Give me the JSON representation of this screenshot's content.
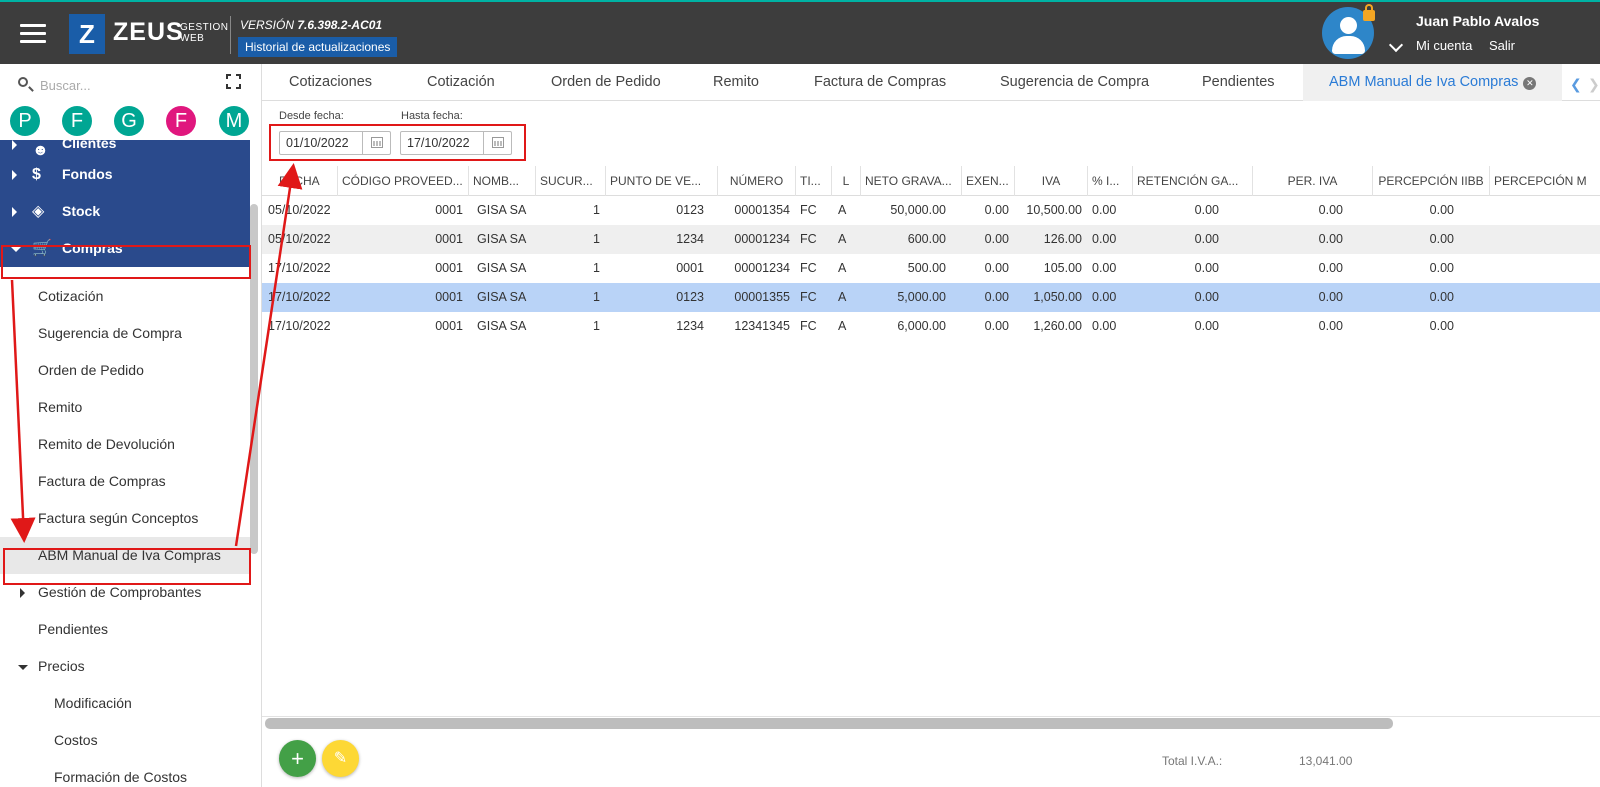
{
  "header": {
    "logo_letter": "Z",
    "logo_word": "ZEUS",
    "logo_sub_1": "GESTION",
    "logo_sub_2": "WEB",
    "version_label": "VERSIÓN",
    "version_number": "7.6.398.2-AC01",
    "history_button": "Historial de actualizaciones",
    "user_name": "Juan Pablo Avalos",
    "account_link": "Mi cuenta",
    "logout_link": "Salir"
  },
  "sidebar": {
    "search_placeholder": "Buscar...",
    "shortcuts": [
      {
        "letter": "P",
        "color": "#00a693"
      },
      {
        "letter": "F",
        "color": "#00a693"
      },
      {
        "letter": "G",
        "color": "#00a693"
      },
      {
        "letter": "F",
        "color": "#e0177e"
      },
      {
        "letter": "M",
        "color": "#00a693"
      }
    ],
    "modules": [
      {
        "label": "Clientes",
        "icon": "users-icon"
      },
      {
        "label": "Fondos",
        "icon": "dollar-icon"
      },
      {
        "label": "Stock",
        "icon": "layers-icon"
      },
      {
        "label": "Compras",
        "icon": "cart-icon"
      }
    ],
    "compras_items": [
      "Cotización",
      "Sugerencia de Compra",
      "Orden de Pedido",
      "Remito",
      "Remito de Devolución",
      "Factura de Compras",
      "Factura según Conceptos",
      "ABM Manual de Iva Compras",
      "Gestión de Comprobantes",
      "Pendientes",
      "Precios",
      "Modificación",
      "Costos",
      "Formación de Costos"
    ]
  },
  "tabs": [
    "Cotizaciones",
    "Cotización",
    "Orden de Pedido",
    "Remito",
    "Factura de Compras",
    "Sugerencia de Compra",
    "Pendientes",
    "ABM Manual de Iva Compras"
  ],
  "filter": {
    "from_label": "Desde fecha:",
    "from_value": "01/10/2022",
    "to_label": "Hasta fecha:",
    "to_value": "17/10/2022"
  },
  "grid": {
    "columns": [
      "FECHA",
      "CÓDIGO PROVEED...",
      "NOMB...",
      "SUCUR...",
      "PUNTO DE VE...",
      "NÚMERO",
      "TI...",
      "L",
      "NETO GRAVA...",
      "EXEN...",
      "IVA",
      "% I...",
      "RETENCIÓN GA...",
      "PER. IVA",
      "PERCEPCIÓN IIBB",
      "PERCEPCIÓN M"
    ],
    "rows": [
      [
        "05/10/2022",
        "0001",
        "GISA SA",
        "1",
        "0123",
        "00001354",
        "FC",
        "A",
        "50,000.00",
        "0.00",
        "10,500.00",
        "0.00",
        "0.00",
        "0.00",
        "0.00"
      ],
      [
        "05/10/2022",
        "0001",
        "GISA SA",
        "1",
        "1234",
        "00001234",
        "FC",
        "A",
        "600.00",
        "0.00",
        "126.00",
        "0.00",
        "0.00",
        "0.00",
        "0.00"
      ],
      [
        "17/10/2022",
        "0001",
        "GISA SA",
        "1",
        "0001",
        "00001234",
        "FC",
        "A",
        "500.00",
        "0.00",
        "105.00",
        "0.00",
        "0.00",
        "0.00",
        "0.00"
      ],
      [
        "17/10/2022",
        "0001",
        "GISA SA",
        "1",
        "0123",
        "00001355",
        "FC",
        "A",
        "5,000.00",
        "0.00",
        "1,050.00",
        "0.00",
        "0.00",
        "0.00",
        "0.00"
      ],
      [
        "17/10/2022",
        "0001",
        "GISA SA",
        "1",
        "1234",
        "12341345",
        "FC",
        "A",
        "6,000.00",
        "0.00",
        "1,260.00",
        "0.00",
        "0.00",
        "0.00",
        "0.00"
      ]
    ],
    "selected_row": 3
  },
  "footer": {
    "total_label": "Total I.V.A.:",
    "total_value": "13,041.00"
  },
  "colors": {
    "topbar": "#3d3d3d",
    "brand_blue": "#1a5da8",
    "menu_blue": "#2a4a8c",
    "active_tab_text": "#2a7bd6",
    "selected_row": "#b9d3f7",
    "add_button": "#43a047",
    "edit_button": "#fdd835",
    "annotation_red": "#e01818"
  }
}
